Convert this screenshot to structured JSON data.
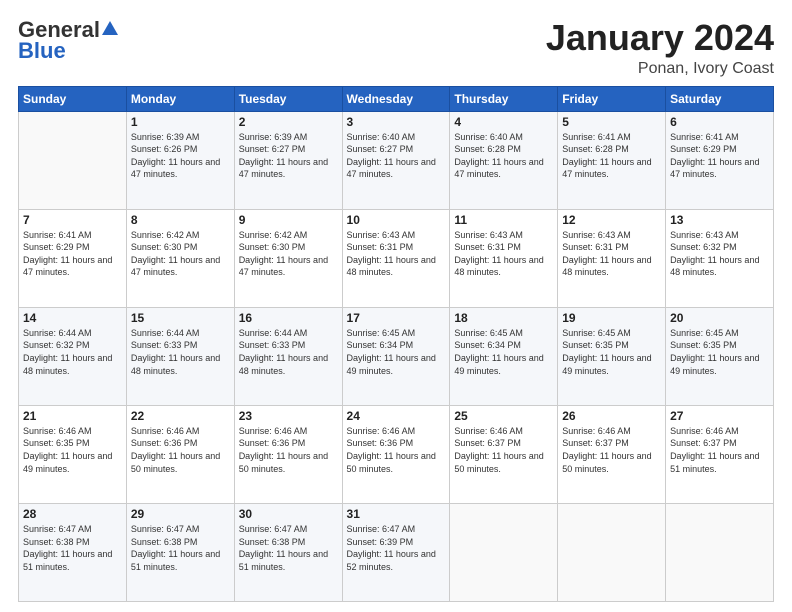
{
  "header": {
    "logo_general": "General",
    "logo_blue": "Blue",
    "main_title": "January 2024",
    "subtitle": "Ponan, Ivory Coast"
  },
  "days_of_week": [
    "Sunday",
    "Monday",
    "Tuesday",
    "Wednesday",
    "Thursday",
    "Friday",
    "Saturday"
  ],
  "weeks": [
    [
      {
        "day": "",
        "sunrise": "",
        "sunset": "",
        "daylight": ""
      },
      {
        "day": "1",
        "sunrise": "Sunrise: 6:39 AM",
        "sunset": "Sunset: 6:26 PM",
        "daylight": "Daylight: 11 hours and 47 minutes."
      },
      {
        "day": "2",
        "sunrise": "Sunrise: 6:39 AM",
        "sunset": "Sunset: 6:27 PM",
        "daylight": "Daylight: 11 hours and 47 minutes."
      },
      {
        "day": "3",
        "sunrise": "Sunrise: 6:40 AM",
        "sunset": "Sunset: 6:27 PM",
        "daylight": "Daylight: 11 hours and 47 minutes."
      },
      {
        "day": "4",
        "sunrise": "Sunrise: 6:40 AM",
        "sunset": "Sunset: 6:28 PM",
        "daylight": "Daylight: 11 hours and 47 minutes."
      },
      {
        "day": "5",
        "sunrise": "Sunrise: 6:41 AM",
        "sunset": "Sunset: 6:28 PM",
        "daylight": "Daylight: 11 hours and 47 minutes."
      },
      {
        "day": "6",
        "sunrise": "Sunrise: 6:41 AM",
        "sunset": "Sunset: 6:29 PM",
        "daylight": "Daylight: 11 hours and 47 minutes."
      }
    ],
    [
      {
        "day": "7",
        "sunrise": "Sunrise: 6:41 AM",
        "sunset": "Sunset: 6:29 PM",
        "daylight": "Daylight: 11 hours and 47 minutes."
      },
      {
        "day": "8",
        "sunrise": "Sunrise: 6:42 AM",
        "sunset": "Sunset: 6:30 PM",
        "daylight": "Daylight: 11 hours and 47 minutes."
      },
      {
        "day": "9",
        "sunrise": "Sunrise: 6:42 AM",
        "sunset": "Sunset: 6:30 PM",
        "daylight": "Daylight: 11 hours and 47 minutes."
      },
      {
        "day": "10",
        "sunrise": "Sunrise: 6:43 AM",
        "sunset": "Sunset: 6:31 PM",
        "daylight": "Daylight: 11 hours and 48 minutes."
      },
      {
        "day": "11",
        "sunrise": "Sunrise: 6:43 AM",
        "sunset": "Sunset: 6:31 PM",
        "daylight": "Daylight: 11 hours and 48 minutes."
      },
      {
        "day": "12",
        "sunrise": "Sunrise: 6:43 AM",
        "sunset": "Sunset: 6:31 PM",
        "daylight": "Daylight: 11 hours and 48 minutes."
      },
      {
        "day": "13",
        "sunrise": "Sunrise: 6:43 AM",
        "sunset": "Sunset: 6:32 PM",
        "daylight": "Daylight: 11 hours and 48 minutes."
      }
    ],
    [
      {
        "day": "14",
        "sunrise": "Sunrise: 6:44 AM",
        "sunset": "Sunset: 6:32 PM",
        "daylight": "Daylight: 11 hours and 48 minutes."
      },
      {
        "day": "15",
        "sunrise": "Sunrise: 6:44 AM",
        "sunset": "Sunset: 6:33 PM",
        "daylight": "Daylight: 11 hours and 48 minutes."
      },
      {
        "day": "16",
        "sunrise": "Sunrise: 6:44 AM",
        "sunset": "Sunset: 6:33 PM",
        "daylight": "Daylight: 11 hours and 48 minutes."
      },
      {
        "day": "17",
        "sunrise": "Sunrise: 6:45 AM",
        "sunset": "Sunset: 6:34 PM",
        "daylight": "Daylight: 11 hours and 49 minutes."
      },
      {
        "day": "18",
        "sunrise": "Sunrise: 6:45 AM",
        "sunset": "Sunset: 6:34 PM",
        "daylight": "Daylight: 11 hours and 49 minutes."
      },
      {
        "day": "19",
        "sunrise": "Sunrise: 6:45 AM",
        "sunset": "Sunset: 6:35 PM",
        "daylight": "Daylight: 11 hours and 49 minutes."
      },
      {
        "day": "20",
        "sunrise": "Sunrise: 6:45 AM",
        "sunset": "Sunset: 6:35 PM",
        "daylight": "Daylight: 11 hours and 49 minutes."
      }
    ],
    [
      {
        "day": "21",
        "sunrise": "Sunrise: 6:46 AM",
        "sunset": "Sunset: 6:35 PM",
        "daylight": "Daylight: 11 hours and 49 minutes."
      },
      {
        "day": "22",
        "sunrise": "Sunrise: 6:46 AM",
        "sunset": "Sunset: 6:36 PM",
        "daylight": "Daylight: 11 hours and 50 minutes."
      },
      {
        "day": "23",
        "sunrise": "Sunrise: 6:46 AM",
        "sunset": "Sunset: 6:36 PM",
        "daylight": "Daylight: 11 hours and 50 minutes."
      },
      {
        "day": "24",
        "sunrise": "Sunrise: 6:46 AM",
        "sunset": "Sunset: 6:36 PM",
        "daylight": "Daylight: 11 hours and 50 minutes."
      },
      {
        "day": "25",
        "sunrise": "Sunrise: 6:46 AM",
        "sunset": "Sunset: 6:37 PM",
        "daylight": "Daylight: 11 hours and 50 minutes."
      },
      {
        "day": "26",
        "sunrise": "Sunrise: 6:46 AM",
        "sunset": "Sunset: 6:37 PM",
        "daylight": "Daylight: 11 hours and 50 minutes."
      },
      {
        "day": "27",
        "sunrise": "Sunrise: 6:46 AM",
        "sunset": "Sunset: 6:37 PM",
        "daylight": "Daylight: 11 hours and 51 minutes."
      }
    ],
    [
      {
        "day": "28",
        "sunrise": "Sunrise: 6:47 AM",
        "sunset": "Sunset: 6:38 PM",
        "daylight": "Daylight: 11 hours and 51 minutes."
      },
      {
        "day": "29",
        "sunrise": "Sunrise: 6:47 AM",
        "sunset": "Sunset: 6:38 PM",
        "daylight": "Daylight: 11 hours and 51 minutes."
      },
      {
        "day": "30",
        "sunrise": "Sunrise: 6:47 AM",
        "sunset": "Sunset: 6:38 PM",
        "daylight": "Daylight: 11 hours and 51 minutes."
      },
      {
        "day": "31",
        "sunrise": "Sunrise: 6:47 AM",
        "sunset": "Sunset: 6:39 PM",
        "daylight": "Daylight: 11 hours and 52 minutes."
      },
      {
        "day": "",
        "sunrise": "",
        "sunset": "",
        "daylight": ""
      },
      {
        "day": "",
        "sunrise": "",
        "sunset": "",
        "daylight": ""
      },
      {
        "day": "",
        "sunrise": "",
        "sunset": "",
        "daylight": ""
      }
    ]
  ]
}
